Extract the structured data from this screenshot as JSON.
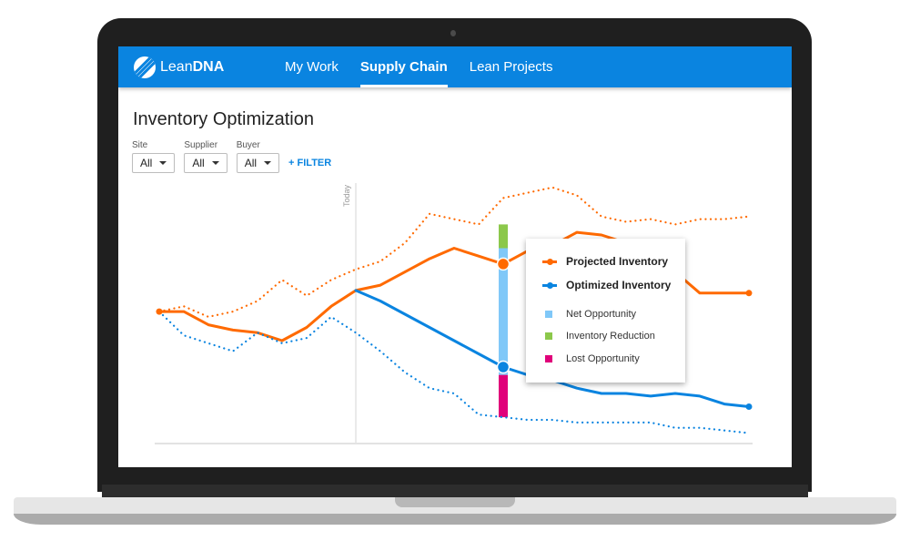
{
  "app": {
    "brand_prefix": "Lean",
    "brand_suffix": "DNA",
    "nav": [
      {
        "label": "My Work",
        "active": false
      },
      {
        "label": "Supply Chain",
        "active": true
      },
      {
        "label": "Lean Projects",
        "active": false
      }
    ]
  },
  "page": {
    "title": "Inventory Optimization",
    "filters": [
      {
        "label": "Site",
        "value": "All"
      },
      {
        "label": "Supplier",
        "value": "All"
      },
      {
        "label": "Buyer",
        "value": "All"
      }
    ],
    "add_filter_label": "+ FILTER"
  },
  "colors": {
    "brand": "#0a84e0",
    "projected": "#ff6a00",
    "optimized": "#0a84e0",
    "net_opportunity": "#80c8f8",
    "inventory_reduction": "#8cc84b",
    "lost_opportunity": "#e0007a"
  },
  "tooltip": {
    "items": [
      {
        "label": "Projected Inventory",
        "kind": "line",
        "color": "#ff6a00"
      },
      {
        "label": "Optimized Inventory",
        "kind": "line",
        "color": "#0a84e0"
      },
      {
        "label": "Net Opportunity",
        "kind": "square",
        "color": "#80c8f8"
      },
      {
        "label": "Inventory Reduction",
        "kind": "square",
        "color": "#8cc84b"
      },
      {
        "label": "Lost Opportunity",
        "kind": "square",
        "color": "#e0007a"
      }
    ]
  },
  "chart_data": {
    "type": "line",
    "title": "Inventory Optimization",
    "xlabel": "",
    "ylabel": "",
    "x": [
      0,
      1,
      2,
      3,
      4,
      5,
      6,
      7,
      8,
      9,
      10,
      11,
      12,
      13,
      14,
      15,
      16,
      17,
      18,
      19,
      20,
      21,
      22,
      23,
      24
    ],
    "today_index": 8,
    "today_label": "Today",
    "ylim": [
      0,
      100
    ],
    "grid": false,
    "series": [
      {
        "name": "Projected Inventory",
        "style": "solid",
        "color": "#ff6a00",
        "values": [
          51,
          51,
          46,
          44,
          43,
          40,
          45,
          53,
          59,
          61,
          66,
          71,
          75,
          72,
          69,
          74,
          76,
          81,
          80,
          77,
          73,
          66,
          58,
          58,
          58
        ]
      },
      {
        "name": "Optimized Inventory",
        "style": "solid",
        "color": "#0a84e0",
        "values": [
          null,
          null,
          null,
          null,
          null,
          null,
          null,
          null,
          59,
          55,
          50,
          45,
          40,
          35,
          30,
          27,
          25,
          22,
          20,
          20,
          19,
          20,
          19,
          16,
          15
        ]
      },
      {
        "name": "Projected Inventory (upper range)",
        "style": "dotted",
        "color": "#ff6a00",
        "values": [
          51,
          53,
          49,
          51,
          55,
          63,
          57,
          63,
          67,
          70,
          77,
          88,
          86,
          84,
          94,
          96,
          98,
          95,
          87,
          85,
          86,
          84,
          86,
          86,
          87
        ]
      },
      {
        "name": "Optimized Inventory (lower range)",
        "style": "dotted",
        "color": "#0a84e0",
        "values": [
          51,
          42,
          39,
          36,
          43,
          39,
          41,
          49,
          43,
          36,
          28,
          22,
          20,
          12,
          11,
          10,
          10,
          9,
          9,
          9,
          9,
          7,
          7,
          6,
          5
        ]
      }
    ],
    "highlight": {
      "index": 14,
      "inventory_reduction_range": [
        84,
        75
      ],
      "net_opportunity_range": [
        75,
        27
      ],
      "lost_opportunity_range": [
        27,
        11
      ]
    }
  }
}
